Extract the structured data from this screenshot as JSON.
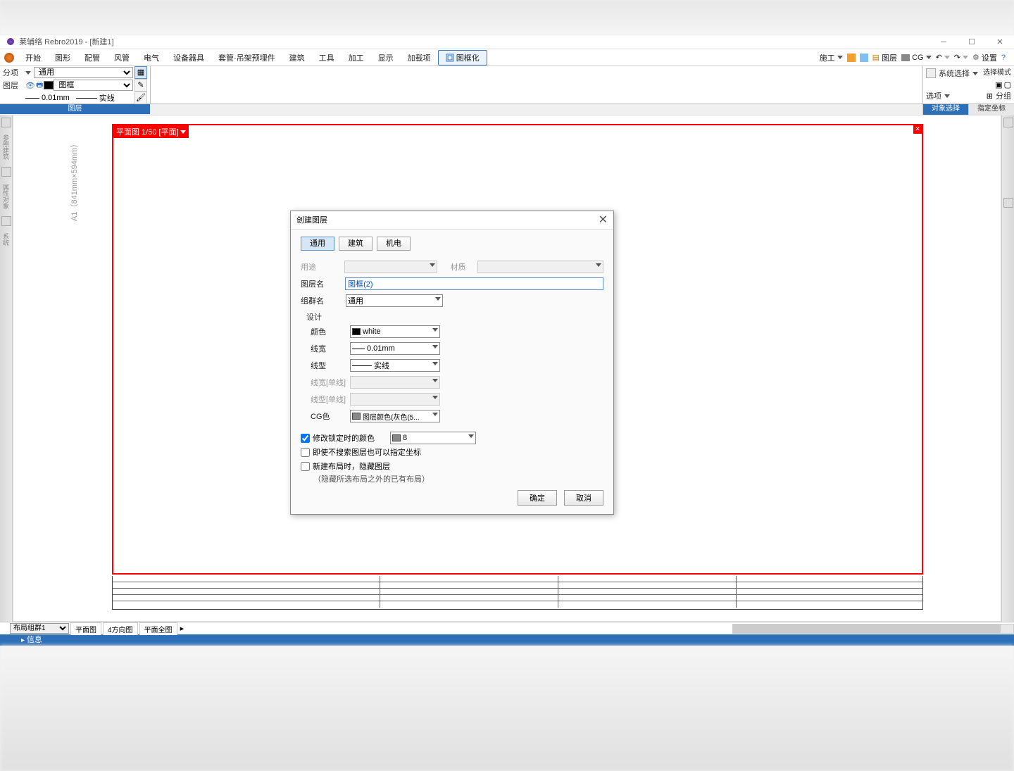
{
  "title": "莱辅络 Rebro2019 - [新建1]",
  "menu": [
    "开始",
    "图形",
    "配管",
    "风管",
    "电气",
    "设备器具",
    "套管·吊架预埋件",
    "建筑",
    "工具",
    "加工",
    "显示",
    "加载项"
  ],
  "menu_active": "图框化",
  "top_right": {
    "construction": "施工",
    "layer": "图层",
    "cg": "CG",
    "settings": "设置"
  },
  "ribbon": {
    "division_label": "分项",
    "division_value": "通用",
    "layer_label": "图层",
    "layer_value": "图框",
    "lineweight": "0.01mm",
    "linetype": "实线",
    "group_label": "图层"
  },
  "ribbon_right": {
    "select_mode": "选择模式",
    "system_select": "系统选择",
    "options": "选项",
    "group": "分组",
    "tab1": "对象选择",
    "tab2": "指定坐标"
  },
  "canvas": {
    "paper": "A1（841mm×594mm）",
    "frame_tab": "平面图 1/50 [平面]"
  },
  "bottom": {
    "layout_group": "布局组群1",
    "tab_plan": "平面图",
    "tab_4dir": "4方向图",
    "tab_planall": "平面全图"
  },
  "status": "信息",
  "dialog": {
    "title": "创建图层",
    "tabs": [
      "通用",
      "建筑",
      "机电"
    ],
    "usage_label": "用途",
    "material_label": "材质",
    "layername_label": "图层名",
    "layername_value": "图框(2)",
    "groupname_label": "组群名",
    "groupname_value": "通用",
    "design_label": "设计",
    "color_label": "颜色",
    "color_value": "white",
    "lineweight_label": "线宽",
    "lineweight_value": "0.01mm",
    "linetype_label": "线型",
    "linetype_value": "实线",
    "lineweight_single_label": "线宽[单线]",
    "linetype_single_label": "线型[单线]",
    "cgcolor_label": "CG色",
    "cgcolor_value": "图层颜色(灰色(5...",
    "check1": "修改锁定时的颜色",
    "lock_color_value": "8",
    "check2": "即使不搜索图层也可以指定坐标",
    "check3": "新建布局时，隐藏图层",
    "check3_note": "（隐藏所选布局之外的已有布局）",
    "ok": "确定",
    "cancel": "取消"
  }
}
